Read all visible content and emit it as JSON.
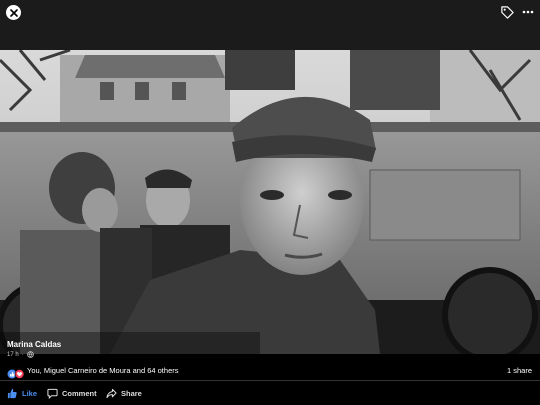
{
  "photo": {
    "description_icons": [
      "close-icon",
      "tag-icon",
      "more-icon"
    ]
  },
  "post": {
    "author": "Marina Caldas",
    "time": "17 h",
    "separator": "·"
  },
  "reactions": {
    "text": "You, Miguel Carneiro de Moura and 64 others",
    "shares": "1 share",
    "icons": [
      "like-reaction-icon",
      "love-reaction-icon"
    ]
  },
  "actions": {
    "like": "Like",
    "comment": "Comment",
    "share": "Share"
  },
  "colors": {
    "like_blue": "#4b8ef0",
    "love_red": "#f33e58",
    "topbar": "#1b1b1b",
    "background": "#000000"
  }
}
